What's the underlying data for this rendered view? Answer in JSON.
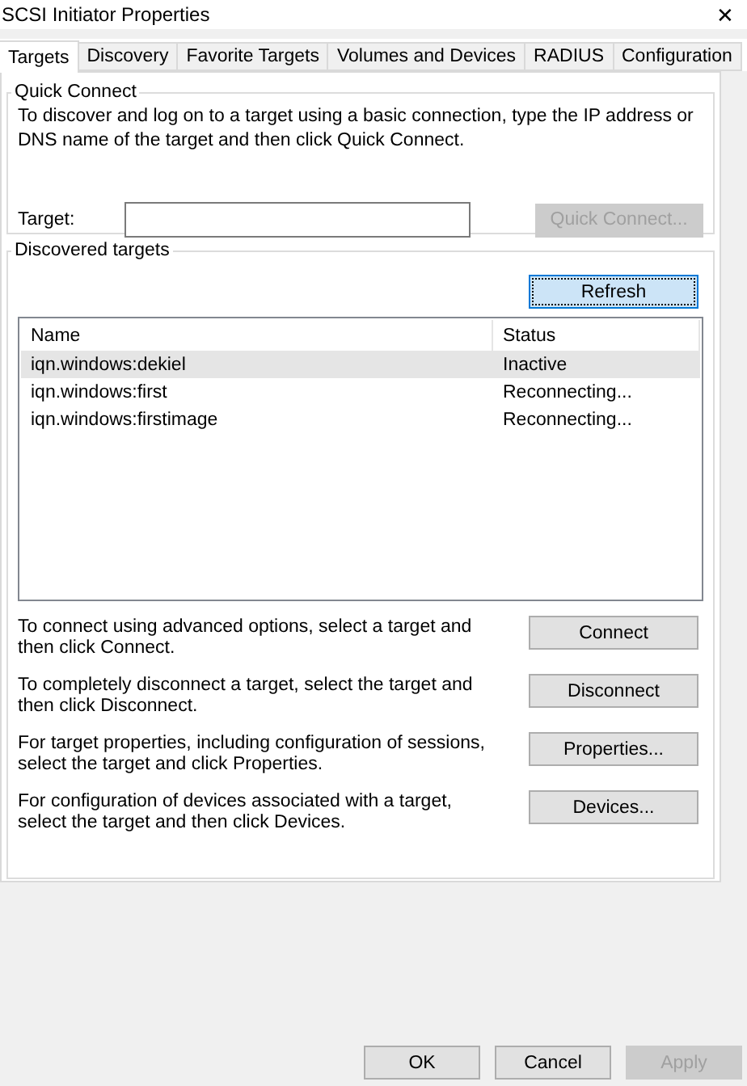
{
  "window": {
    "title": "SCSI Initiator Properties",
    "close": "✕"
  },
  "tabs": [
    {
      "label": "Targets",
      "selected": true
    },
    {
      "label": "Discovery",
      "selected": false
    },
    {
      "label": "Favorite Targets",
      "selected": false
    },
    {
      "label": "Volumes and Devices",
      "selected": false
    },
    {
      "label": "RADIUS",
      "selected": false
    },
    {
      "label": "Configuration",
      "selected": false
    }
  ],
  "quick_connect": {
    "title": "Quick Connect",
    "description": "To discover and log on to a target using a basic connection, type the IP address or DNS name of the target and then click Quick Connect.",
    "target_label": "Target:",
    "button": {
      "label": "Quick Connect...",
      "disabled": true
    }
  },
  "discovered": {
    "title": "Discovered targets",
    "refresh": {
      "label": "Refresh",
      "focused": true
    },
    "columns": [
      "Name",
      "Status"
    ],
    "rows": [
      {
        "name": "iqn.windows:dekiel",
        "status": "Inactive",
        "selected": true
      },
      {
        "name": "iqn.windows:first",
        "status": "Reconnecting...",
        "selected": false
      },
      {
        "name": "iqn.windows:firstimage",
        "status": "Reconnecting...",
        "selected": false
      }
    ],
    "actions": [
      {
        "description": "To connect using advanced options, select a target and then click Connect.",
        "button": "Connect"
      },
      {
        "description": "To completely disconnect a target, select the target and then click Disconnect.",
        "button": "Disconnect"
      },
      {
        "description": "For target properties, including configuration of sessions, select the target and click Properties.",
        "button": "Properties..."
      },
      {
        "description": "For configuration of devices associated with a target, select the target and then click Devices.",
        "button": "Devices..."
      }
    ]
  },
  "footer": [
    {
      "label": "OK",
      "disabled": false
    },
    {
      "label": "Cancel",
      "disabled": false
    },
    {
      "label": "Apply",
      "disabled": true
    }
  ]
}
